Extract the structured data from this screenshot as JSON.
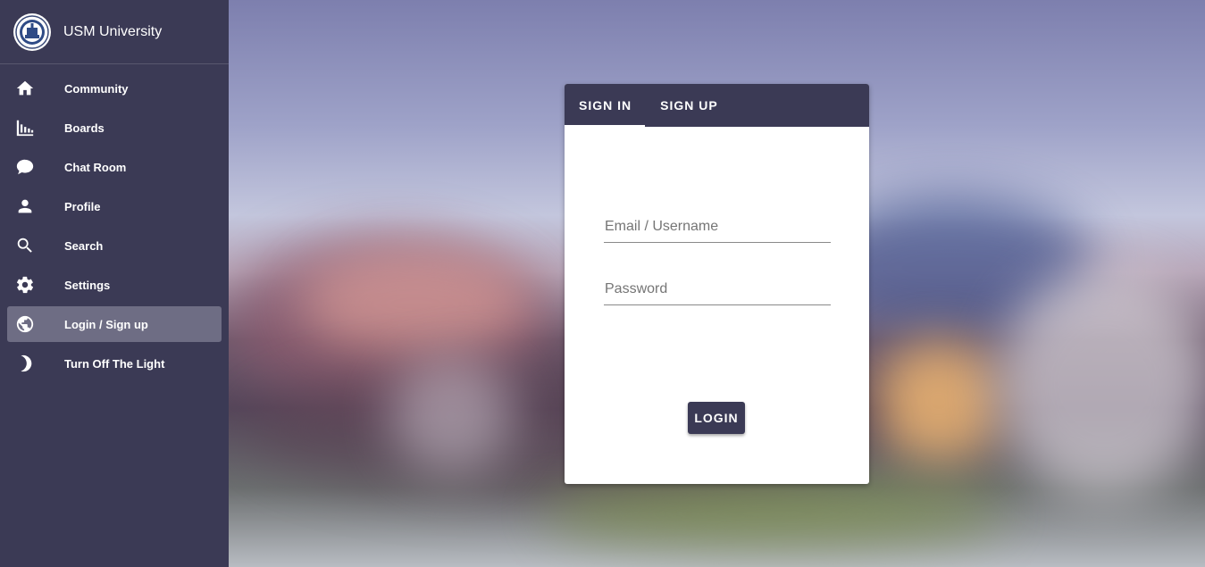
{
  "brand": {
    "title": "USM University"
  },
  "sidebar": {
    "items": [
      {
        "label": "Community",
        "icon": "home-icon"
      },
      {
        "label": "Boards",
        "icon": "bar-chart-icon"
      },
      {
        "label": "Chat Room",
        "icon": "chat-bubble-icon"
      },
      {
        "label": "Profile",
        "icon": "person-icon"
      },
      {
        "label": "Search",
        "icon": "search-icon"
      },
      {
        "label": "Settings",
        "icon": "gear-icon"
      },
      {
        "label": "Login / Sign up",
        "icon": "globe-icon",
        "active": true
      },
      {
        "label": "Turn Off The Light",
        "icon": "moon-icon"
      }
    ]
  },
  "auth": {
    "tabs": [
      {
        "label": "SIGN IN",
        "active": true
      },
      {
        "label": "SIGN UP"
      }
    ],
    "email_placeholder": "Email / Username",
    "password_placeholder": "Password",
    "login_label": "LOGIN"
  },
  "colors": {
    "sidebar": "#3b3a55",
    "active_item": "#6e6d84",
    "card": "#ffffff"
  }
}
